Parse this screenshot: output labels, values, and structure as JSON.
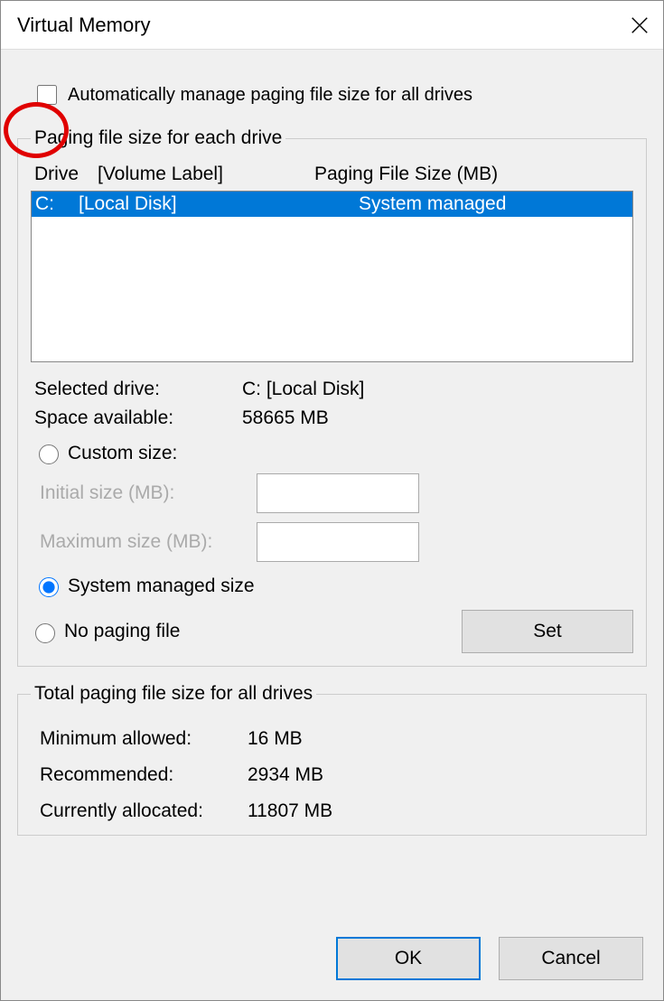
{
  "window": {
    "title": "Virtual Memory"
  },
  "auto_manage": {
    "label": "Automatically manage paging file size for all drives",
    "checked": false
  },
  "group1": {
    "legend": "Paging file size for each drive",
    "headers": {
      "drive": "Drive",
      "volume": "[Volume Label]",
      "size": "Paging File Size (MB)"
    },
    "rows": [
      {
        "drive": "C:",
        "volume": "[Local Disk]",
        "size": "System managed",
        "selected": true
      }
    ],
    "selected_drive": {
      "label": "Selected drive:",
      "value": "C:  [Local Disk]"
    },
    "space_available": {
      "label": "Space available:",
      "value": "58665 MB"
    },
    "custom_size": {
      "label": "Custom size:",
      "selected": false
    },
    "initial_size": {
      "label": "Initial size (MB):",
      "value": ""
    },
    "maximum_size": {
      "label": "Maximum size (MB):",
      "value": ""
    },
    "system_managed": {
      "label": "System managed size",
      "selected": true
    },
    "no_paging": {
      "label": "No paging file",
      "selected": false
    },
    "set_button": "Set"
  },
  "group2": {
    "legend": "Total paging file size for all drives",
    "min_allowed": {
      "label": "Minimum allowed:",
      "value": "16 MB"
    },
    "recommended": {
      "label": "Recommended:",
      "value": "2934 MB"
    },
    "currently_allocated": {
      "label": "Currently allocated:",
      "value": "11807 MB"
    }
  },
  "buttons": {
    "ok": "OK",
    "cancel": "Cancel"
  }
}
